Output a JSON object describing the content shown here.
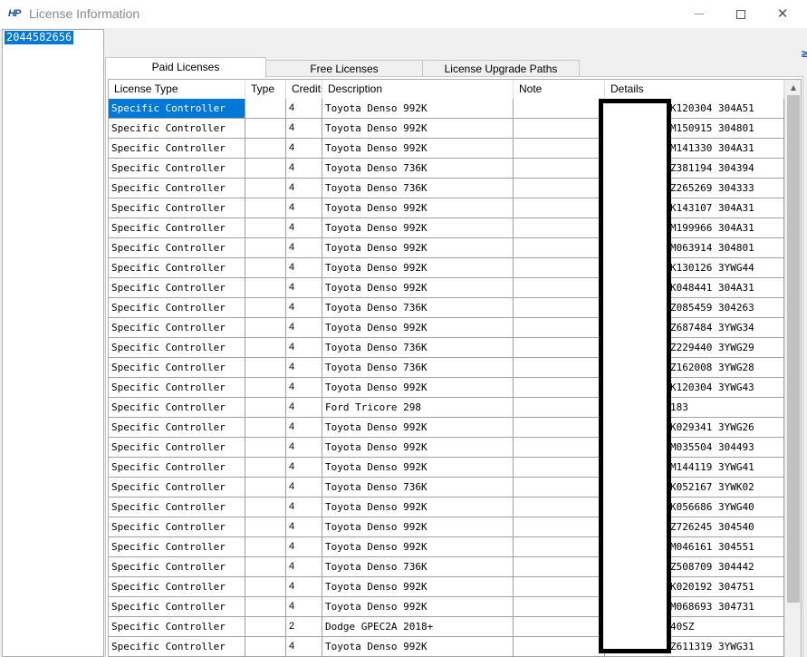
{
  "window": {
    "title": "License Information",
    "app_icon_text": "HP",
    "controls": {
      "minimize": "minimize",
      "maximize": "maximize",
      "close": "✕"
    }
  },
  "sidebar": {
    "items": [
      "2044582656"
    ]
  },
  "tabs": [
    {
      "label": "Paid Licenses",
      "active": true
    },
    {
      "label": "Free Licenses",
      "active": false
    },
    {
      "label": "License Upgrade Paths",
      "active": false
    }
  ],
  "table": {
    "columns": [
      "License Type",
      "Type",
      "Credits",
      "Description",
      "Note",
      "Details"
    ],
    "rows": [
      {
        "license_type": "Specific Controller",
        "type": "",
        "credits": "4",
        "description": "Toyota Denso 992K",
        "note": "",
        "details": "K120304 304A51",
        "selected": true
      },
      {
        "license_type": "Specific Controller",
        "type": "",
        "credits": "4",
        "description": "Toyota Denso 992K",
        "note": "",
        "details": "M150915 304801"
      },
      {
        "license_type": "Specific Controller",
        "type": "",
        "credits": "4",
        "description": "Toyota Denso 992K",
        "note": "",
        "details": "M141330 304A31"
      },
      {
        "license_type": "Specific Controller",
        "type": "",
        "credits": "4",
        "description": "Toyota Denso 736K",
        "note": "",
        "details": "Z381194 304394"
      },
      {
        "license_type": "Specific Controller",
        "type": "",
        "credits": "4",
        "description": "Toyota Denso 736K",
        "note": "",
        "details": "Z265269 304333"
      },
      {
        "license_type": "Specific Controller",
        "type": "",
        "credits": "4",
        "description": "Toyota Denso 992K",
        "note": "",
        "details": "K143107 304A31"
      },
      {
        "license_type": "Specific Controller",
        "type": "",
        "credits": "4",
        "description": "Toyota Denso 992K",
        "note": "",
        "details": "M199966 304A31"
      },
      {
        "license_type": "Specific Controller",
        "type": "",
        "credits": "4",
        "description": "Toyota Denso 992K",
        "note": "",
        "details": "M063914 304801"
      },
      {
        "license_type": "Specific Controller",
        "type": "",
        "credits": "4",
        "description": "Toyota Denso 992K",
        "note": "",
        "details": "K130126 3YWG44"
      },
      {
        "license_type": "Specific Controller",
        "type": "",
        "credits": "4",
        "description": "Toyota Denso 992K",
        "note": "",
        "details": "K048441 304A31"
      },
      {
        "license_type": "Specific Controller",
        "type": "",
        "credits": "4",
        "description": "Toyota Denso 736K",
        "note": "",
        "details": "Z085459 304263"
      },
      {
        "license_type": "Specific Controller",
        "type": "",
        "credits": "4",
        "description": "Toyota Denso 992K",
        "note": "",
        "details": "Z687484 3YWG34"
      },
      {
        "license_type": "Specific Controller",
        "type": "",
        "credits": "4",
        "description": "Toyota Denso 736K",
        "note": "",
        "details": "Z229440 3YWG29"
      },
      {
        "license_type": "Specific Controller",
        "type": "",
        "credits": "4",
        "description": "Toyota Denso 736K",
        "note": "",
        "details": "Z162008 3YWG28"
      },
      {
        "license_type": "Specific Controller",
        "type": "",
        "credits": "4",
        "description": "Toyota Denso 992K",
        "note": "",
        "details": "K120304 3YWG43"
      },
      {
        "license_type": "Specific Controller",
        "type": "",
        "credits": "4",
        "description": "Ford Tricore 298",
        "note": "",
        "details": "183"
      },
      {
        "license_type": "Specific Controller",
        "type": "",
        "credits": "4",
        "description": "Toyota Denso 992K",
        "note": "",
        "details": "K029341 3YWG26"
      },
      {
        "license_type": "Specific Controller",
        "type": "",
        "credits": "4",
        "description": "Toyota Denso 992K",
        "note": "",
        "details": "M035504 304493"
      },
      {
        "license_type": "Specific Controller",
        "type": "",
        "credits": "4",
        "description": "Toyota Denso 992K",
        "note": "",
        "details": "M144119 3YWG41"
      },
      {
        "license_type": "Specific Controller",
        "type": "",
        "credits": "4",
        "description": "Toyota Denso 736K",
        "note": "",
        "details": "K052167 3YWK02"
      },
      {
        "license_type": "Specific Controller",
        "type": "",
        "credits": "4",
        "description": "Toyota Denso 992K",
        "note": "",
        "details": "K056686 3YWG40"
      },
      {
        "license_type": "Specific Controller",
        "type": "",
        "credits": "4",
        "description": "Toyota Denso 992K",
        "note": "",
        "details": "Z726245 304540"
      },
      {
        "license_type": "Specific Controller",
        "type": "",
        "credits": "4",
        "description": "Toyota Denso 992K",
        "note": "",
        "details": "M046161 304551"
      },
      {
        "license_type": "Specific Controller",
        "type": "",
        "credits": "4",
        "description": "Toyota Denso 736K",
        "note": "",
        "details": "Z508709 304442"
      },
      {
        "license_type": "Specific Controller",
        "type": "",
        "credits": "4",
        "description": "Toyota Denso 992K",
        "note": "",
        "details": "K020192 304751"
      },
      {
        "license_type": "Specific Controller",
        "type": "",
        "credits": "4",
        "description": "Toyota Denso 992K",
        "note": "",
        "details": "M068693 304731"
      },
      {
        "license_type": "Specific Controller",
        "type": "",
        "credits": "2",
        "description": "Dodge GPEC2A 2018+",
        "note": "",
        "details": "40SZ"
      },
      {
        "license_type": "Specific Controller",
        "type": "",
        "credits": "4",
        "description": "Toyota Denso 992K",
        "note": "",
        "details": "Z611319 3YWG31"
      }
    ]
  },
  "scrollbar": {
    "up_arrow": "▲"
  },
  "colors": {
    "selection": "#0078d7",
    "grid_line": "#a0a0a0",
    "redaction": "#000000"
  }
}
